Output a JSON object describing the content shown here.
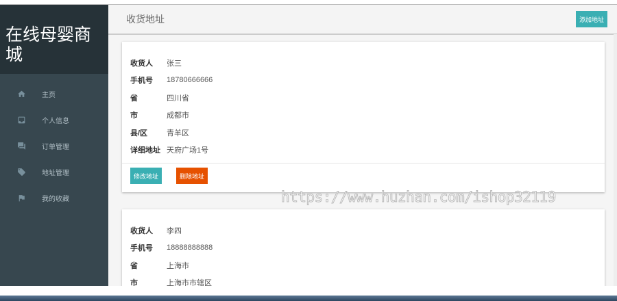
{
  "app": {
    "brand": "在线母婴商城"
  },
  "sidebar": {
    "items": [
      {
        "label": "主页",
        "icon": "home-icon"
      },
      {
        "label": "个人信息",
        "icon": "inbox-icon"
      },
      {
        "label": "订单管理",
        "icon": "forum-icon"
      },
      {
        "label": "地址管理",
        "icon": "tag-icon"
      },
      {
        "label": "我的收藏",
        "icon": "flag-icon"
      }
    ]
  },
  "header": {
    "title": "收货地址",
    "add_label": "添加地址"
  },
  "labels": {
    "name": "收货人",
    "phone": "手机号",
    "province": "省",
    "city": "市",
    "district": "县/区",
    "detail": "详细地址",
    "edit": "修改地址",
    "delete": "删除地址"
  },
  "addresses": [
    {
      "name": "张三",
      "phone": "18780666666",
      "province": "四川省",
      "city": "成都市",
      "district": "青羊区",
      "detail": "天府广场1号"
    },
    {
      "name": "李四",
      "phone": "18888888888",
      "province": "上海市",
      "city": "上海市市辖区"
    }
  ],
  "watermark": "https://www.huzhan.com/ishop32119"
}
